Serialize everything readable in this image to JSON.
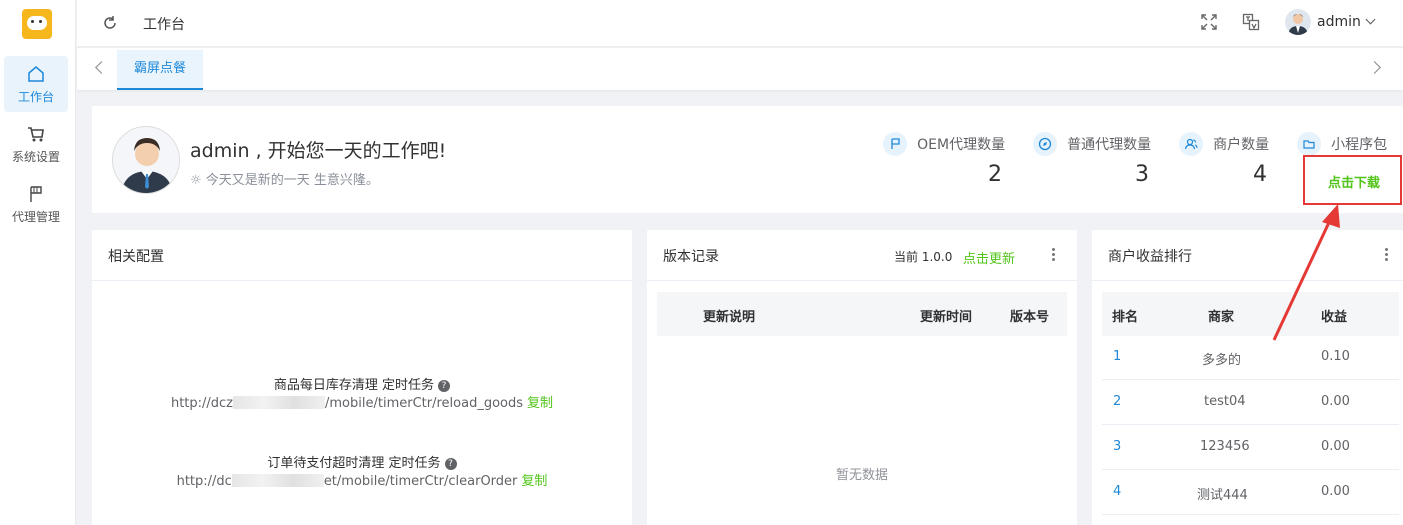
{
  "sidebar": {
    "items": [
      {
        "label": "工作台",
        "icon": "home-icon",
        "active": true
      },
      {
        "label": "系统设置",
        "icon": "cart-icon",
        "active": false
      },
      {
        "label": "代理管理",
        "icon": "flag-icon",
        "active": false
      }
    ]
  },
  "header": {
    "breadcrumb": "工作台",
    "username": "admin"
  },
  "tabs": [
    {
      "label": "霸屏点餐",
      "active": true
    }
  ],
  "welcome": {
    "greeting": "admin , 开始您一天的工作吧!",
    "subtitle": "今天又是新的一天 生意兴隆。",
    "stats": [
      {
        "label": "OEM代理数量",
        "value": "2",
        "icon": "flag-icon"
      },
      {
        "label": "普通代理数量",
        "value": "3",
        "icon": "compass-icon"
      },
      {
        "label": "商户数量",
        "value": "4",
        "icon": "users-icon"
      },
      {
        "label": "小程序包",
        "icon": "folder-icon"
      }
    ],
    "download_label": "点击下载"
  },
  "config_panel": {
    "title": "相关配置",
    "tasks": [
      {
        "name": "商品每日库存清理 定时任务",
        "url_prefix": "http://dcz",
        "url_suffix": "/mobile/timerCtr/reload_goods",
        "copy_label": "复制"
      },
      {
        "name": "订单待支付超时清理 定时任务",
        "url_prefix": "http://dc",
        "url_suffix": "et/mobile/timerCtr/clearOrder",
        "copy_label": "复制"
      }
    ]
  },
  "version_panel": {
    "title": "版本记录",
    "current_label": "当前 1.0.0",
    "update_label": "点击更新",
    "columns": [
      "更新说明",
      "更新时间",
      "版本号"
    ],
    "empty_text": "暂无数据"
  },
  "ranking_panel": {
    "title": "商户收益排行",
    "columns": [
      "排名",
      "商家",
      "收益"
    ],
    "rows": [
      {
        "rank": "1",
        "merchant": "多多的",
        "income": "0.10"
      },
      {
        "rank": "2",
        "merchant": "test04",
        "income": "0.00"
      },
      {
        "rank": "3",
        "merchant": "123456",
        "income": "0.00"
      },
      {
        "rank": "4",
        "merchant": "测试444",
        "income": "0.00"
      }
    ]
  },
  "colors": {
    "accent": "#1e88d8",
    "success": "#52c41a",
    "annotation": "#e53935"
  }
}
